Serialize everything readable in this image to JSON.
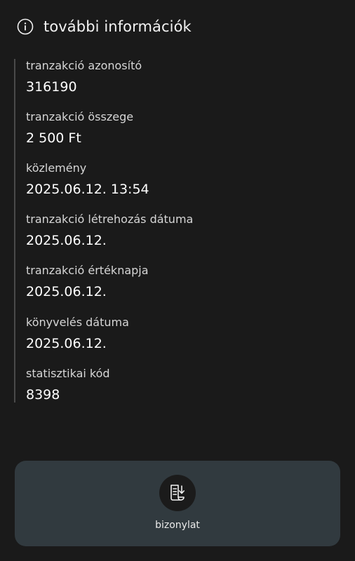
{
  "header": {
    "icon": "info-icon",
    "title": "további információk"
  },
  "details": [
    {
      "label": "tranzakció azonosító",
      "value": "316190"
    },
    {
      "label": "tranzakció összege",
      "value": "2 500 Ft"
    },
    {
      "label": "közlemény",
      "value": "2025.06.12. 13:54"
    },
    {
      "label": "tranzakció létrehozás dátuma",
      "value": "2025.06.12."
    },
    {
      "label": "tranzakció értéknapja",
      "value": "2025.06.12."
    },
    {
      "label": "könyvelés dátuma",
      "value": "2025.06.12."
    },
    {
      "label": "statisztikai kód",
      "value": "8398"
    }
  ],
  "receipt": {
    "icon": "receipt-download-icon",
    "label": "bizonylat"
  },
  "colors": {
    "background": "#1a1a1a",
    "card": "#313a3f",
    "divider": "#4a4a4a"
  }
}
